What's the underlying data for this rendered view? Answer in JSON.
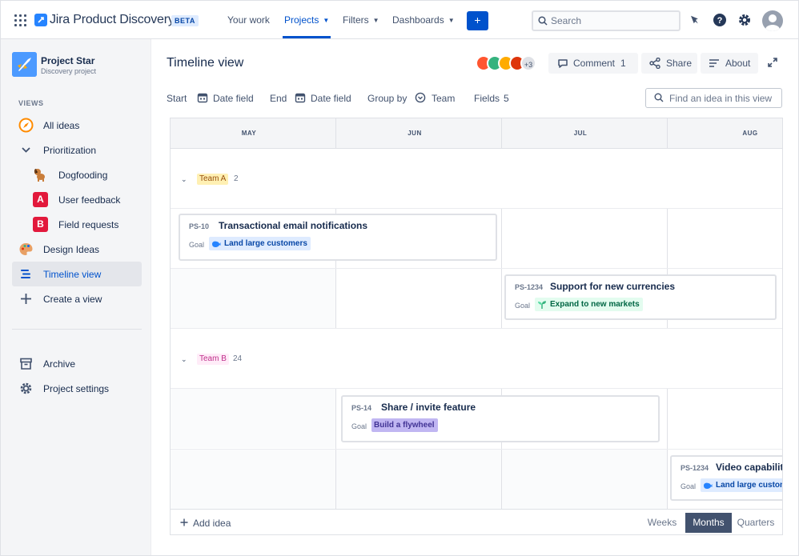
{
  "app": {
    "title": "Jira Product Discovery",
    "badge": "BETA"
  },
  "topnav": {
    "items": [
      {
        "label": "Your work"
      },
      {
        "label": "Projects"
      },
      {
        "label": "Filters"
      },
      {
        "label": "Dashboards"
      }
    ],
    "create_label": "+",
    "search_placeholder": "Search"
  },
  "project": {
    "name": "Project Star",
    "type": "Discovery project"
  },
  "sidebar": {
    "views_header": "VIEWS",
    "items": [
      {
        "label": "All ideas",
        "icon": "compass-icon"
      },
      {
        "label": "Prioritization",
        "icon": "chevron-down-icon"
      },
      {
        "label": "Dogfooding",
        "icon": "dog-icon"
      },
      {
        "label": "User feedback",
        "icon": "letter-a-icon",
        "letter": "A"
      },
      {
        "label": "Field requests",
        "icon": "letter-b-icon",
        "letter": "B"
      },
      {
        "label": "Design Ideas",
        "icon": "palette-icon"
      },
      {
        "label": "Timeline view",
        "icon": "timeline-icon"
      },
      {
        "label": "Create a view",
        "icon": "plus-icon"
      }
    ],
    "footer": [
      {
        "label": "Archive",
        "icon": "archive-icon"
      },
      {
        "label": "Project settings",
        "icon": "gear-icon"
      }
    ]
  },
  "header": {
    "title": "Timeline view",
    "avatars_more": "+3",
    "comment_label": "Comment",
    "comment_count": "1",
    "share_label": "Share",
    "about_label": "About"
  },
  "filters": {
    "start_label": "Start",
    "start_value": "Date field",
    "end_label": "End",
    "end_value": "Date field",
    "group_label": "Group by",
    "group_value": "Team",
    "fields_label": "Fields",
    "fields_count": "5",
    "find_placeholder": "Find an idea in this view"
  },
  "timeline": {
    "months": [
      "MAY",
      "JUN",
      "JUL",
      "AUG"
    ],
    "groups": [
      {
        "label": "Team A",
        "count": "2"
      },
      {
        "label": "Team B",
        "count": "24"
      }
    ],
    "cards": [
      {
        "key": "PS-10",
        "title": "Transactional email notifications",
        "goal_label": "Goal",
        "goal": "Land large customers"
      },
      {
        "key": "PS-1234",
        "title": "Support for new currencies",
        "goal_label": "Goal",
        "goal": "Expand to new markets"
      },
      {
        "key": "PS-14",
        "title": "Share / invite feature",
        "goal_label": "Goal",
        "goal": "Build a flywheel"
      },
      {
        "key": "PS-1234",
        "title": "Video capabilities",
        "goal_label": "Goal",
        "goal": "Land large customers"
      }
    ],
    "add_idea_label": "Add idea",
    "scale": {
      "options": [
        "Weeks",
        "Months",
        "Quarters"
      ],
      "selected": "Months"
    }
  },
  "colors": {
    "brand_blue": "#0052cc",
    "team_a_bg": "#fff0b3",
    "team_a_text": "#974f0c",
    "team_b_bg": "#ffecf8",
    "team_b_text": "#bf2f8a",
    "goal_blue_bg": "#deebff",
    "goal_green_bg": "#e3fcef",
    "goal_purple_bg": "#c0b6f2"
  }
}
